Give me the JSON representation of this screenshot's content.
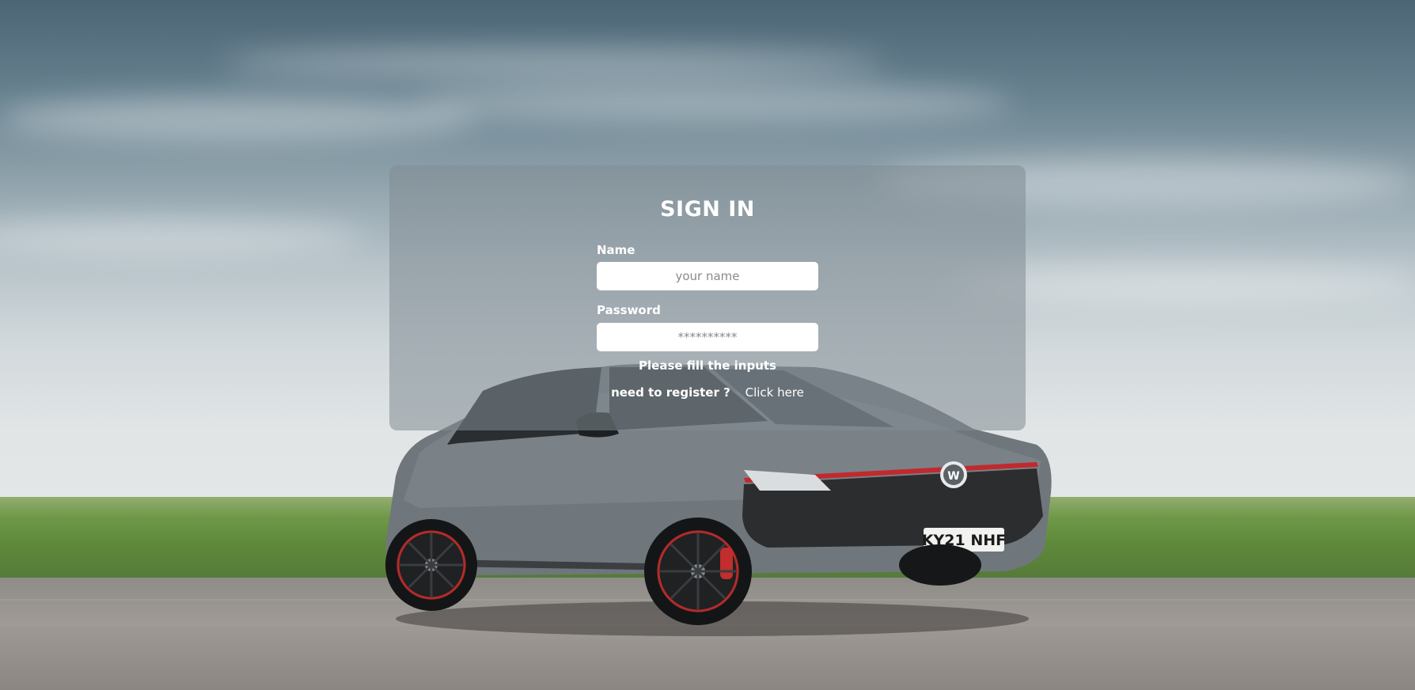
{
  "signin": {
    "title": "SIGN IN",
    "name_label": "Name",
    "name_placeholder": "your name",
    "name_value": "",
    "password_label": "Password",
    "password_placeholder": "**********",
    "password_value": "",
    "validation_message": "Please fill the inputs",
    "register_prompt": "need to register ?",
    "register_link": "Click here"
  },
  "background": {
    "image": "car-photo",
    "plate_text": "KY21 NHF"
  },
  "colors": {
    "panel": "#828c94",
    "text": "#ffffff",
    "input_bg": "#ffffff"
  }
}
